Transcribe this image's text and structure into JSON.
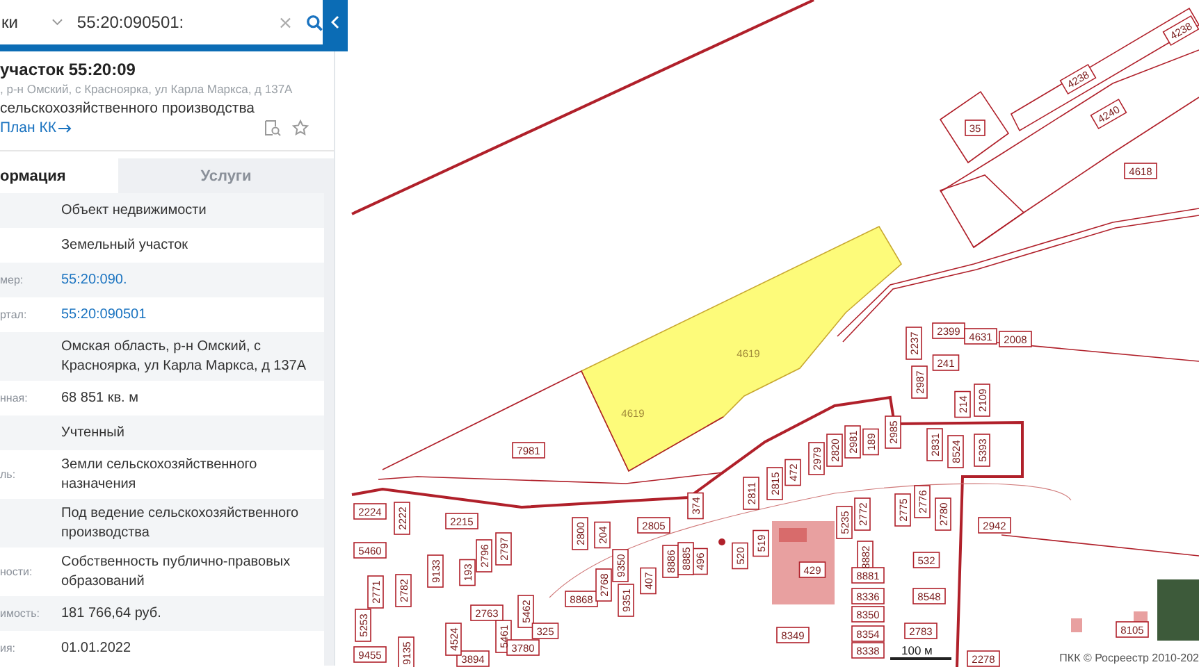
{
  "search": {
    "category": "ки",
    "value": "55:20:090501:"
  },
  "card": {
    "title": "участок 55:20:09",
    "address": ", р-н Омский, с Красноярка, ул Карла Маркса, д 137А",
    "purpose": "сельскохозяйственного производства",
    "link": "План КК"
  },
  "tabs": [
    {
      "label": "ормация",
      "selected": true
    },
    {
      "label": "Услуги",
      "selected": false
    }
  ],
  "rows": [
    {
      "value": "Объект недвижимости",
      "kind": "text"
    },
    {
      "value": "Земельный участок",
      "kind": "text"
    },
    {
      "label": "мер:",
      "value": "55:20:090.",
      "kind": "link"
    },
    {
      "label": "ртал:",
      "value": "55:20:090501",
      "kind": "link"
    },
    {
      "value": "Омская область, р-н Омский, с Красноярка, ул Карла Маркса, д 137А",
      "kind": "text"
    },
    {
      "label": "нная:",
      "value": "68 851 кв. м",
      "kind": "text"
    },
    {
      "value": "Учтенный",
      "kind": "text"
    },
    {
      "label": "ль:",
      "value": "Земли сельскохозяйственного назначения",
      "kind": "text"
    },
    {
      "value": "Под ведение сельскохозяйственного производства",
      "kind": "text"
    },
    {
      "label": "ности:",
      "value": "Собственность публично-правовых образований",
      "kind": "text"
    },
    {
      "label": "имость:",
      "value": "181 766,64 руб.",
      "kind": "text"
    },
    {
      "label": "ия:",
      "value": "01.01.2022",
      "kind": "text"
    }
  ],
  "map": {
    "parcels": [
      {
        "number": "4238",
        "selected": false
      },
      {
        "number": "4238",
        "selected": false
      },
      {
        "number": "4240",
        "selected": false
      },
      {
        "number": "35",
        "selected": false
      },
      {
        "number": "4618",
        "selected": false
      },
      {
        "number": "4619",
        "selected": true
      },
      {
        "number": "4619",
        "selected": true
      },
      {
        "number": "7981",
        "selected": false
      },
      {
        "number": "2399",
        "selected": false
      },
      {
        "number": "4631",
        "selected": false
      },
      {
        "number": "2008",
        "selected": false
      },
      {
        "number": "2237",
        "selected": false
      },
      {
        "number": "241",
        "selected": false
      },
      {
        "number": "2987",
        "selected": false
      },
      {
        "number": "214",
        "selected": false
      },
      {
        "number": "2109",
        "selected": false
      },
      {
        "number": "2831",
        "selected": false
      },
      {
        "number": "8524",
        "selected": false
      },
      {
        "number": "5393",
        "selected": false
      },
      {
        "number": "2224",
        "selected": false
      },
      {
        "number": "2222",
        "selected": false
      },
      {
        "number": "2215",
        "selected": false
      },
      {
        "number": "2800",
        "selected": false
      },
      {
        "number": "204",
        "selected": false
      },
      {
        "number": "2805",
        "selected": false
      },
      {
        "number": "374",
        "selected": false
      },
      {
        "number": "2811",
        "selected": false
      },
      {
        "number": "2815",
        "selected": false
      },
      {
        "number": "472",
        "selected": false
      },
      {
        "number": "2979",
        "selected": false
      },
      {
        "number": "2820",
        "selected": false
      },
      {
        "number": "2981",
        "selected": false
      },
      {
        "number": "189",
        "selected": false
      },
      {
        "number": "2985",
        "selected": false
      },
      {
        "number": "496",
        "selected": false
      },
      {
        "number": "520",
        "selected": false
      },
      {
        "number": "519",
        "selected": false
      },
      {
        "number": "429",
        "selected": false
      },
      {
        "number": "5235",
        "selected": false
      },
      {
        "number": "2772",
        "selected": false
      },
      {
        "number": "2775",
        "selected": false
      },
      {
        "number": "2776",
        "selected": false
      },
      {
        "number": "2780",
        "selected": false
      },
      {
        "number": "2942",
        "selected": false
      },
      {
        "number": "532",
        "selected": false
      },
      {
        "number": "8548",
        "selected": false
      },
      {
        "number": "8882",
        "selected": false
      },
      {
        "number": "8881",
        "selected": false
      },
      {
        "number": "8336",
        "selected": false
      },
      {
        "number": "8350",
        "selected": false
      },
      {
        "number": "8354",
        "selected": false
      },
      {
        "number": "8338",
        "selected": false
      },
      {
        "number": "2783",
        "selected": false
      },
      {
        "number": "8349",
        "selected": false
      },
      {
        "number": "8105",
        "selected": false
      },
      {
        "number": "2278",
        "selected": false
      },
      {
        "number": "5460",
        "selected": false
      },
      {
        "number": "9133",
        "selected": false
      },
      {
        "number": "193",
        "selected": false
      },
      {
        "number": "2796",
        "selected": false
      },
      {
        "number": "2797",
        "selected": false
      },
      {
        "number": "2782",
        "selected": false
      },
      {
        "number": "2771",
        "selected": false
      },
      {
        "number": "8868",
        "selected": false
      },
      {
        "number": "2768",
        "selected": false
      },
      {
        "number": "9350",
        "selected": false
      },
      {
        "number": "9351",
        "selected": false
      },
      {
        "number": "407",
        "selected": false
      },
      {
        "number": "8886",
        "selected": false
      },
      {
        "number": "8885",
        "selected": false
      },
      {
        "number": "2763",
        "selected": false
      },
      {
        "number": "5462",
        "selected": false
      },
      {
        "number": "5461",
        "selected": false
      },
      {
        "number": "325",
        "selected": false
      },
      {
        "number": "3780",
        "selected": false
      },
      {
        "number": "3894",
        "selected": false
      },
      {
        "number": "4524",
        "selected": false
      },
      {
        "number": "5253",
        "selected": false
      },
      {
        "number": "9455",
        "selected": false
      },
      {
        "number": "9135",
        "selected": false
      }
    ],
    "scale": "100 м",
    "copyright": "ПКК © Росреестр 2010-202"
  }
}
